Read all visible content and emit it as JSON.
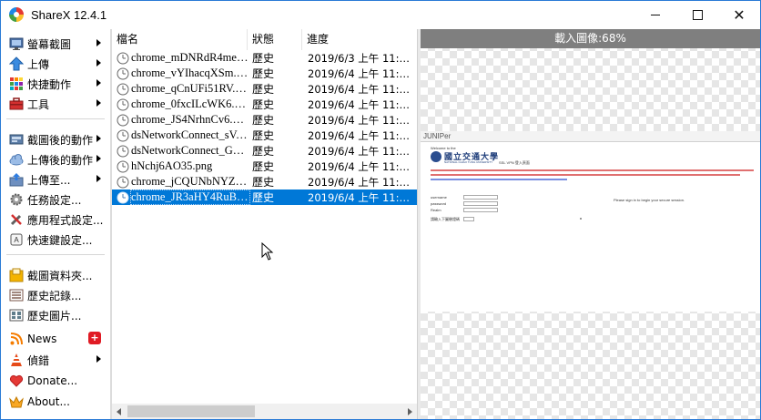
{
  "window": {
    "title": "ShareX 12.4.1",
    "accent_color": "#0078d7"
  },
  "sidebar": {
    "items": [
      {
        "label": "螢幕截圖",
        "icon": "monitor-icon",
        "submenu": true
      },
      {
        "label": "上傳",
        "icon": "upload-arrow-icon",
        "submenu": true
      },
      {
        "label": "快捷動作",
        "icon": "grid-icon",
        "submenu": true
      },
      {
        "label": "工具",
        "icon": "toolbox-icon",
        "submenu": true
      },
      {
        "label": "截圖後的動作",
        "icon": "after-capture-icon",
        "submenu": true
      },
      {
        "label": "上傳後的動作",
        "icon": "cloud-icon",
        "submenu": true
      },
      {
        "label": "上傳至...",
        "icon": "upload-destination-icon",
        "submenu": true
      },
      {
        "label": "任務設定...",
        "icon": "gear-icon",
        "submenu": false
      },
      {
        "label": "應用程式設定...",
        "icon": "wrench-icon",
        "submenu": false
      },
      {
        "label": "快速鍵設定...",
        "icon": "keyboard-icon",
        "submenu": false
      },
      {
        "label": "截圖資料夾...",
        "icon": "folder-icon",
        "submenu": false
      },
      {
        "label": "歷史記錄...",
        "icon": "history-icon",
        "submenu": false
      },
      {
        "label": "歷史圖片...",
        "icon": "image-history-icon",
        "submenu": false
      },
      {
        "label": "News",
        "icon": "news-icon",
        "submenu": false,
        "badge": "+"
      },
      {
        "label": "偵錯",
        "icon": "debug-icon",
        "submenu": true
      },
      {
        "label": "Donate...",
        "icon": "heart-icon",
        "submenu": false
      },
      {
        "label": "About...",
        "icon": "crown-icon",
        "submenu": false
      }
    ]
  },
  "list": {
    "columns": {
      "name": "檔名",
      "status": "狀態",
      "progress": "進度"
    },
    "rows": [
      {
        "name": "chrome_mDNRdR4meT...",
        "status": "歷史",
        "progress": "2019/6/3 上午 11:22:..."
      },
      {
        "name": "chrome_vYIhacqXSm.png",
        "status": "歷史",
        "progress": "2019/6/4 上午 11:00:..."
      },
      {
        "name": "chrome_qCnUFi51RV.p...",
        "status": "歷史",
        "progress": "2019/6/4 上午 11:00:..."
      },
      {
        "name": "chrome_0fxcILcWK6.png",
        "status": "歷史",
        "progress": "2019/6/4 上午 11:01:..."
      },
      {
        "name": "chrome_JS4NrhnCv6.png",
        "status": "歷史",
        "progress": "2019/6/4 上午 11:02:..."
      },
      {
        "name": "dsNetworkConnect_sVA...",
        "status": "歷史",
        "progress": "2019/6/4 上午 11:03:..."
      },
      {
        "name": "dsNetworkConnect_GFJt...",
        "status": "歷史",
        "progress": "2019/6/4 上午 11:03:..."
      },
      {
        "name": "hNchj6AO35.png",
        "status": "歷史",
        "progress": "2019/6/4 上午 11:04:..."
      },
      {
        "name": "chrome_jCQUNbNYZ.png",
        "status": "歷史",
        "progress": "2019/6/4 上午 11:05:..."
      },
      {
        "name": "chrome_JR3aHY4RuB.p...",
        "status": "歷史",
        "progress": "2019/6/4 上午 11:08:...",
        "selected": true
      }
    ]
  },
  "preview": {
    "loading_text": "載入圖像:68%",
    "loading_percent": 68,
    "page": {
      "brand": "JUNIPer",
      "welcome": "Welcome to the",
      "university": "國立交通大學",
      "university_sub": "NATIONAL CHIAO TUNG UNIVERSITY",
      "ssl_title": "SSL VPN 登入頁面",
      "hint": "Please sign in to begin your secure session.",
      "labels": [
        "username",
        "password",
        "Realm",
        "請輸入下圖驗證碼"
      ]
    }
  }
}
